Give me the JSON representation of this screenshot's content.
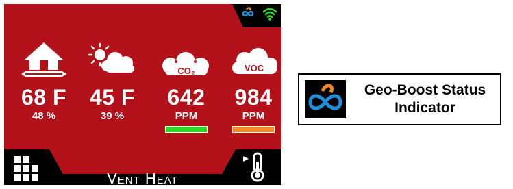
{
  "sensors": [
    {
      "icon": "indoor-home-icon",
      "value": "68 F",
      "sub": "48 %"
    },
    {
      "icon": "outdoor-weather-icon",
      "value": "45 F",
      "sub": "39 %"
    },
    {
      "icon": "co2-cloud-icon",
      "icon_text": "CO₂",
      "value": "642",
      "sub": "PPM",
      "bar_color": "#22dd22"
    },
    {
      "icon": "voc-cloud-icon",
      "icon_text": "VOC",
      "value": "984",
      "sub": "PPM",
      "bar_color": "#f08a24"
    }
  ],
  "mode": {
    "label": "Vent Heat"
  },
  "status": {
    "logo_icon": "geo-boost-logo-icon",
    "wifi_icon": "wifi-icon",
    "wifi_color": "#22dd22"
  },
  "legend": {
    "title_line1": "Geo-Boost Status",
    "title_line2": "Indicator"
  },
  "colors": {
    "screen_bg": "#b3121a",
    "logo_blue": "#1f8fe0",
    "logo_orange": "#f08a24"
  }
}
